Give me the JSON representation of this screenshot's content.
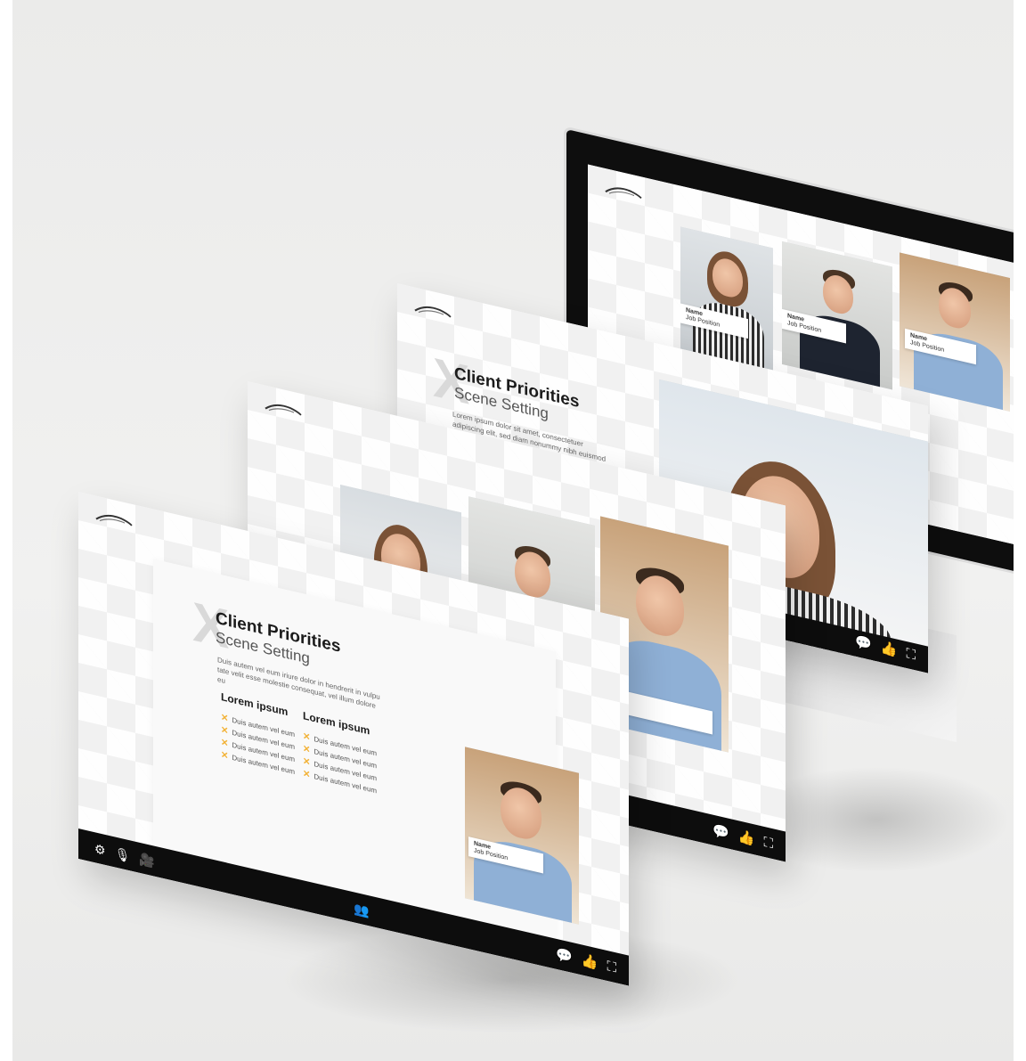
{
  "colors": {
    "bar": "#0d0d0d",
    "accent_bullet": "#f2b134",
    "background": "#ececeb"
  },
  "slide_text": {
    "title": "Client Priorities",
    "subtitle": "Scene Setting",
    "x_glyph": "X",
    "intro_short": "Lorem ipsum dolor sit amet, consectetuer adipiscing elit, sed diam nonummy nibh euismod tincidunt ut laoreet",
    "intro_long": "Duis autem vel eum iriure dolor in hendrerit in vulpu tate velit esse molestie consequat, vel illum dolore eu",
    "column_heading_1": "Lorem ipsum",
    "column_heading_2": "Lorem ipsum",
    "bullet_item": "Duis autem vel eum",
    "bullet_mark": "✕"
  },
  "bullets_col1": [
    "Duis autem vel eum",
    "Duis autem vel eum",
    "Duis autem vel eum",
    "Duis autem vel eum"
  ],
  "bullets_col2": [
    "Duis autem vel eum",
    "Duis autem vel eum",
    "Duis autem vel eum",
    "Duis autem vel eum"
  ],
  "name_tag": {
    "label": "Name",
    "value": "Job Position"
  },
  "toolbar": {
    "chat_icon": "💬",
    "like_icon": "👍",
    "fullscreen_icon": "⛶",
    "settings_icon": "⚙",
    "mic_icon": "🎙",
    "camera_icon": "🎥",
    "group_icon": "👥"
  },
  "icons": [
    "logo-icon",
    "chat-icon",
    "like-icon",
    "fullscreen-icon",
    "settings-icon",
    "microphone-icon",
    "camera-icon",
    "group-icon"
  ]
}
